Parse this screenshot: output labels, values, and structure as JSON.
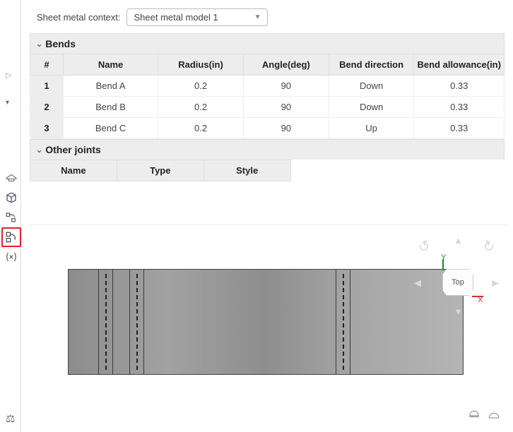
{
  "context": {
    "label": "Sheet metal context:",
    "selected": "Sheet metal model 1"
  },
  "bends": {
    "title": "Bends",
    "columns": {
      "idx": "#",
      "name": "Name",
      "radius": "Radius(in)",
      "angle": "Angle(deg)",
      "direction": "Bend direction",
      "allowance": "Bend allowance(in)"
    },
    "rows": [
      {
        "idx": "1",
        "name": "Bend A",
        "radius": "0.2",
        "angle": "90",
        "direction": "Down",
        "allowance": "0.33"
      },
      {
        "idx": "2",
        "name": "Bend B",
        "radius": "0.2",
        "angle": "90",
        "direction": "Down",
        "allowance": "0.33"
      },
      {
        "idx": "3",
        "name": "Bend C",
        "radius": "0.2",
        "angle": "90",
        "direction": "Up",
        "allowance": "0.33"
      }
    ]
  },
  "joints": {
    "title": "Other joints",
    "columns": {
      "name": "Name",
      "type": "Type",
      "style": "Style"
    }
  },
  "viewcube": {
    "face": "Top",
    "axis_x": "X",
    "axis_y": "Y"
  }
}
